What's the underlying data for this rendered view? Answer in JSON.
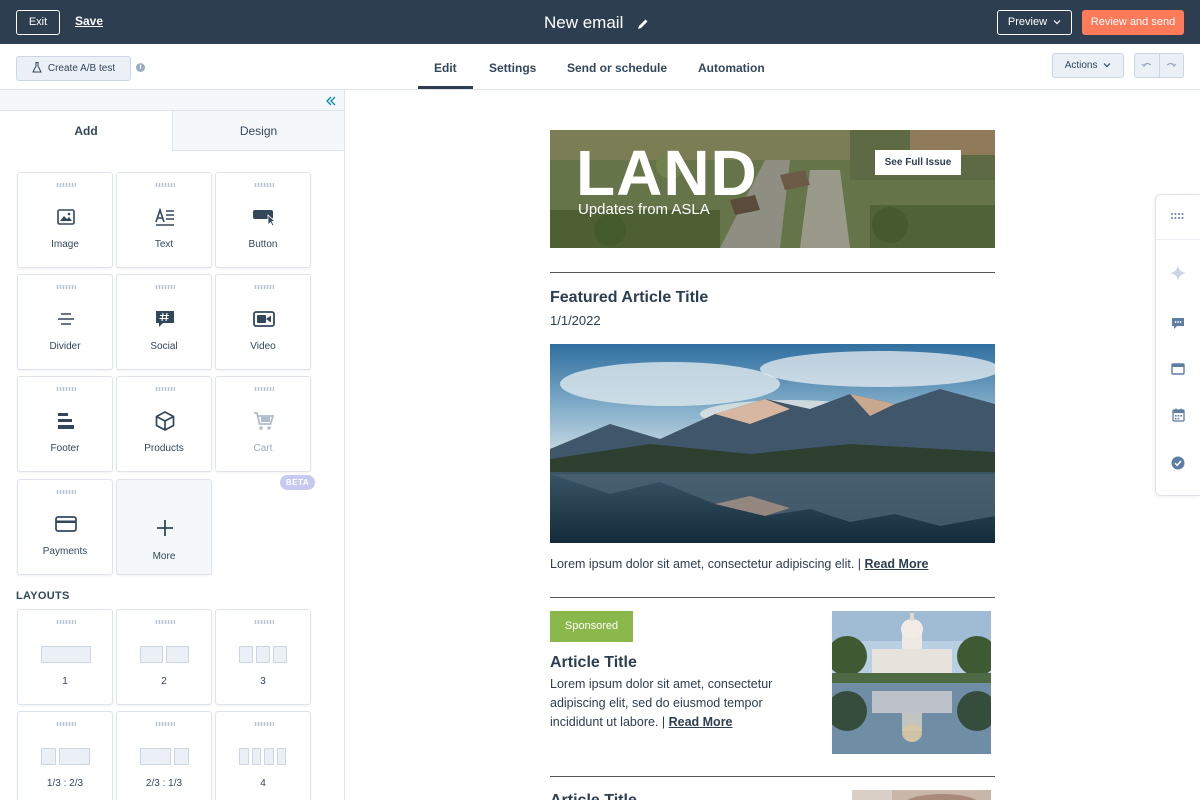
{
  "topbar": {
    "exit_label": "Exit",
    "save_label": "Save",
    "title": "New email",
    "preview_label": "Preview",
    "review_label": "Review and send"
  },
  "subbar": {
    "ab_test_label": "Create A/B test",
    "tabs": [
      {
        "label": "Edit",
        "active": true
      },
      {
        "label": "Settings",
        "active": false
      },
      {
        "label": "Send or schedule",
        "active": false
      },
      {
        "label": "Automation",
        "active": false
      }
    ],
    "actions_label": "Actions"
  },
  "panel": {
    "tabs": [
      {
        "label": "Add",
        "active": true
      },
      {
        "label": "Design",
        "active": false
      }
    ],
    "modules": [
      {
        "label": "Image",
        "icon": "image-icon"
      },
      {
        "label": "Text",
        "icon": "text-icon"
      },
      {
        "label": "Button",
        "icon": "button-cursor-icon"
      },
      {
        "label": "Divider",
        "icon": "divider-icon"
      },
      {
        "label": "Social",
        "icon": "social-hashtag-icon"
      },
      {
        "label": "Video",
        "icon": "video-camera-icon"
      },
      {
        "label": "Footer",
        "icon": "footer-icon"
      },
      {
        "label": "Products",
        "icon": "box-icon"
      },
      {
        "label": "Cart",
        "icon": "cart-icon",
        "disabled": true
      },
      {
        "label": "Payments",
        "icon": "credit-card-icon"
      },
      {
        "label": "More",
        "icon": "plus-icon"
      }
    ],
    "beta_badge": "BETA",
    "layouts_heading": "LAYOUTS",
    "layouts": [
      {
        "label": "1"
      },
      {
        "label": "2"
      },
      {
        "label": "3"
      },
      {
        "label": "1/3 : 2/3"
      },
      {
        "label": "2/3 : 1/3"
      },
      {
        "label": "4"
      }
    ]
  },
  "email": {
    "hero": {
      "title": "LAND",
      "subtitle": "Updates from ASLA",
      "button": "See Full Issue"
    },
    "featured": {
      "title": "Featured Article Title",
      "date": "1/1/2022",
      "body": "Lorem ipsum dolor sit amet, consectetur adipiscing elit. | ",
      "link": "Read More"
    },
    "article": {
      "badge": "Sponsored",
      "title": "Article Title",
      "line1": "Lorem ipsum dolor sit amet, consectetur",
      "line2": "adipiscing elit, sed do eiusmod tempor",
      "line3": "incididunt ut labore. | ",
      "link": "Read More"
    },
    "next_title": "Article Title"
  },
  "colors": {
    "topbar": "#2d3e50",
    "accent_orange": "#ff7a59",
    "sponsored_green": "#8ab84a",
    "beta_purple": "#c7c9f0"
  }
}
